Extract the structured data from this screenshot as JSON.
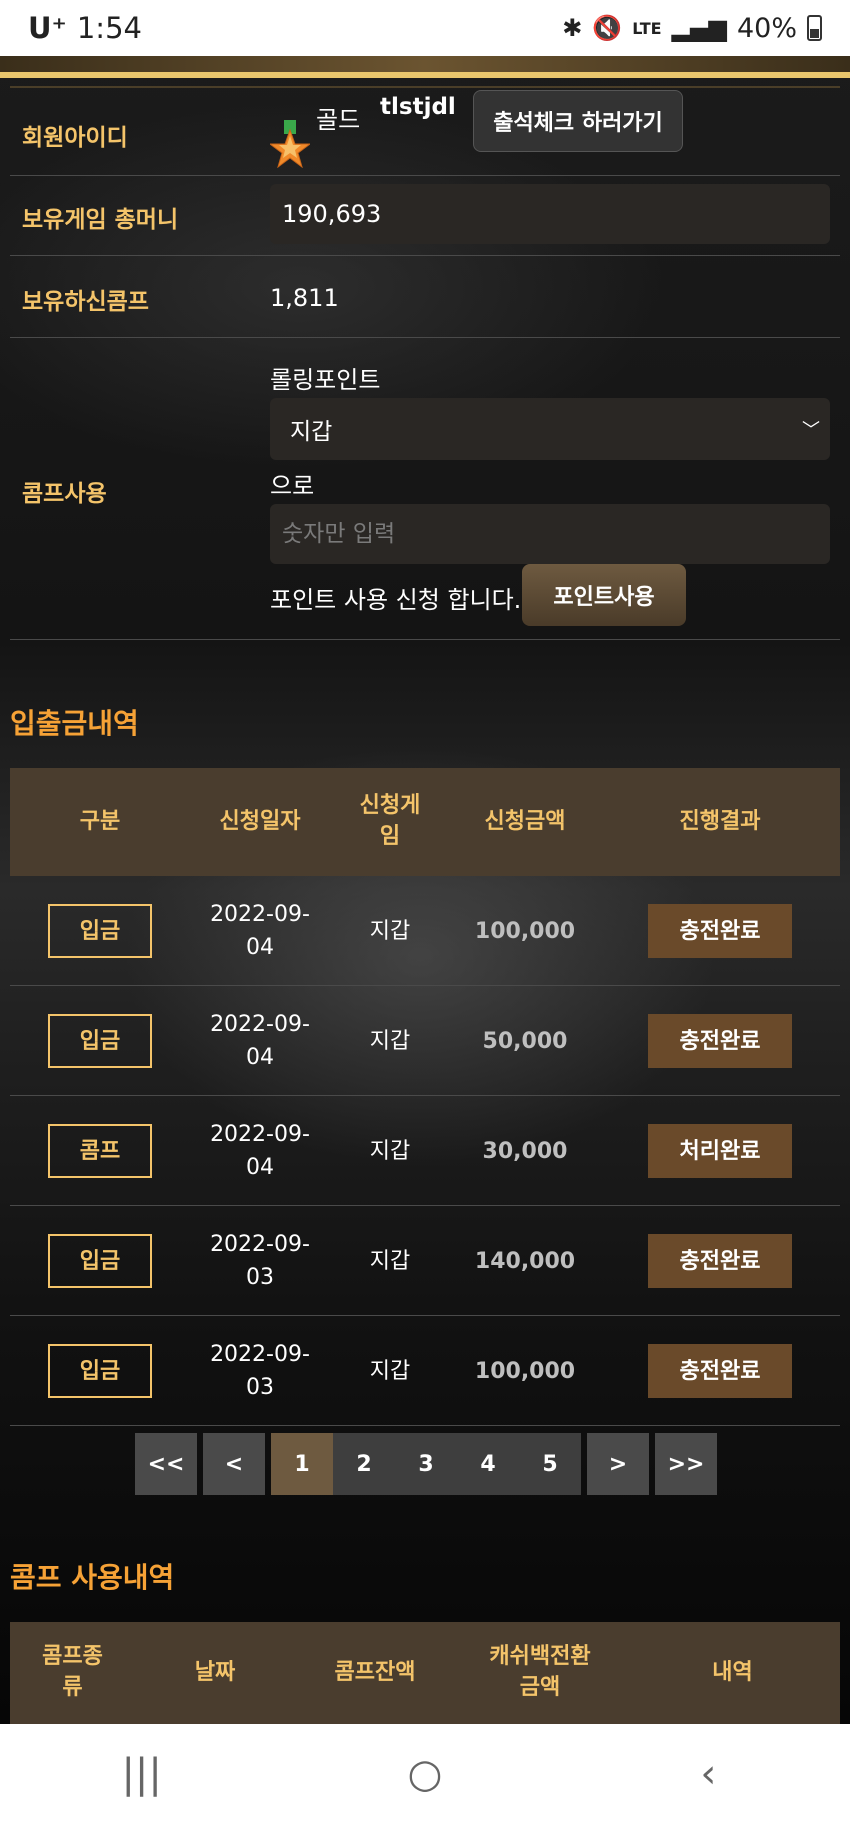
{
  "status_bar": {
    "carrier": "U⁺",
    "time": "1:54",
    "battery": "40%",
    "icons": [
      "bluetooth-icon",
      "mute-icon",
      "lte-icon",
      "signal-icon",
      "battery-icon"
    ]
  },
  "profile": {
    "member_id_label": "회원아이디",
    "grade": "골드",
    "user_id": "tlstjdl",
    "attendance_button": "출석체크 하러가기",
    "money_label": "보유게임 총머니",
    "money_value": "190,693",
    "comp_label": "보유하신콤프",
    "comp_value": "1,811",
    "comp_use_label": "콤프사용",
    "rolling_label": "롤링포인트",
    "wallet_select": "지갑",
    "to_label": "으로",
    "amount_placeholder": "숫자만 입력",
    "apply_text": "포인트 사용 신청 합니다.",
    "point_button": "포인트사용"
  },
  "deposit_history": {
    "title": "입출금내역",
    "headers": [
      "구분",
      "신청일자",
      "신청게\n임",
      "신청금액",
      "진행결과"
    ],
    "rows": [
      {
        "type": "입금",
        "date": "2022-09-\n04",
        "game": "지갑",
        "amount": "100,000",
        "result": "충전완료"
      },
      {
        "type": "입금",
        "date": "2022-09-\n04",
        "game": "지갑",
        "amount": "50,000",
        "result": "충전완료"
      },
      {
        "type": "콤프",
        "date": "2022-09-\n04",
        "game": "지갑",
        "amount": "30,000",
        "result": "처리완료"
      },
      {
        "type": "입금",
        "date": "2022-09-\n03",
        "game": "지갑",
        "amount": "140,000",
        "result": "충전완료"
      },
      {
        "type": "입금",
        "date": "2022-09-\n03",
        "game": "지갑",
        "amount": "100,000",
        "result": "충전완료"
      }
    ]
  },
  "pagination": {
    "first": "<<",
    "prev": "<",
    "pages": [
      "1",
      "2",
      "3",
      "4",
      "5"
    ],
    "active_page": "1",
    "next": ">",
    "last": ">>"
  },
  "comp_history": {
    "title": "콤프 사용내역",
    "headers": [
      "콤프종\n류",
      "날짜",
      "콤프잔액",
      "캐쉬백전환\n금액",
      "내역"
    ]
  },
  "nav_bar": {
    "recent": "|||",
    "home": "○",
    "back": "‹"
  },
  "colors": {
    "accent_gold": "#f4c46a",
    "section_orange": "#f6a236",
    "header_brown": "#4a3d2e",
    "result_brown": "#6a4a2a"
  }
}
